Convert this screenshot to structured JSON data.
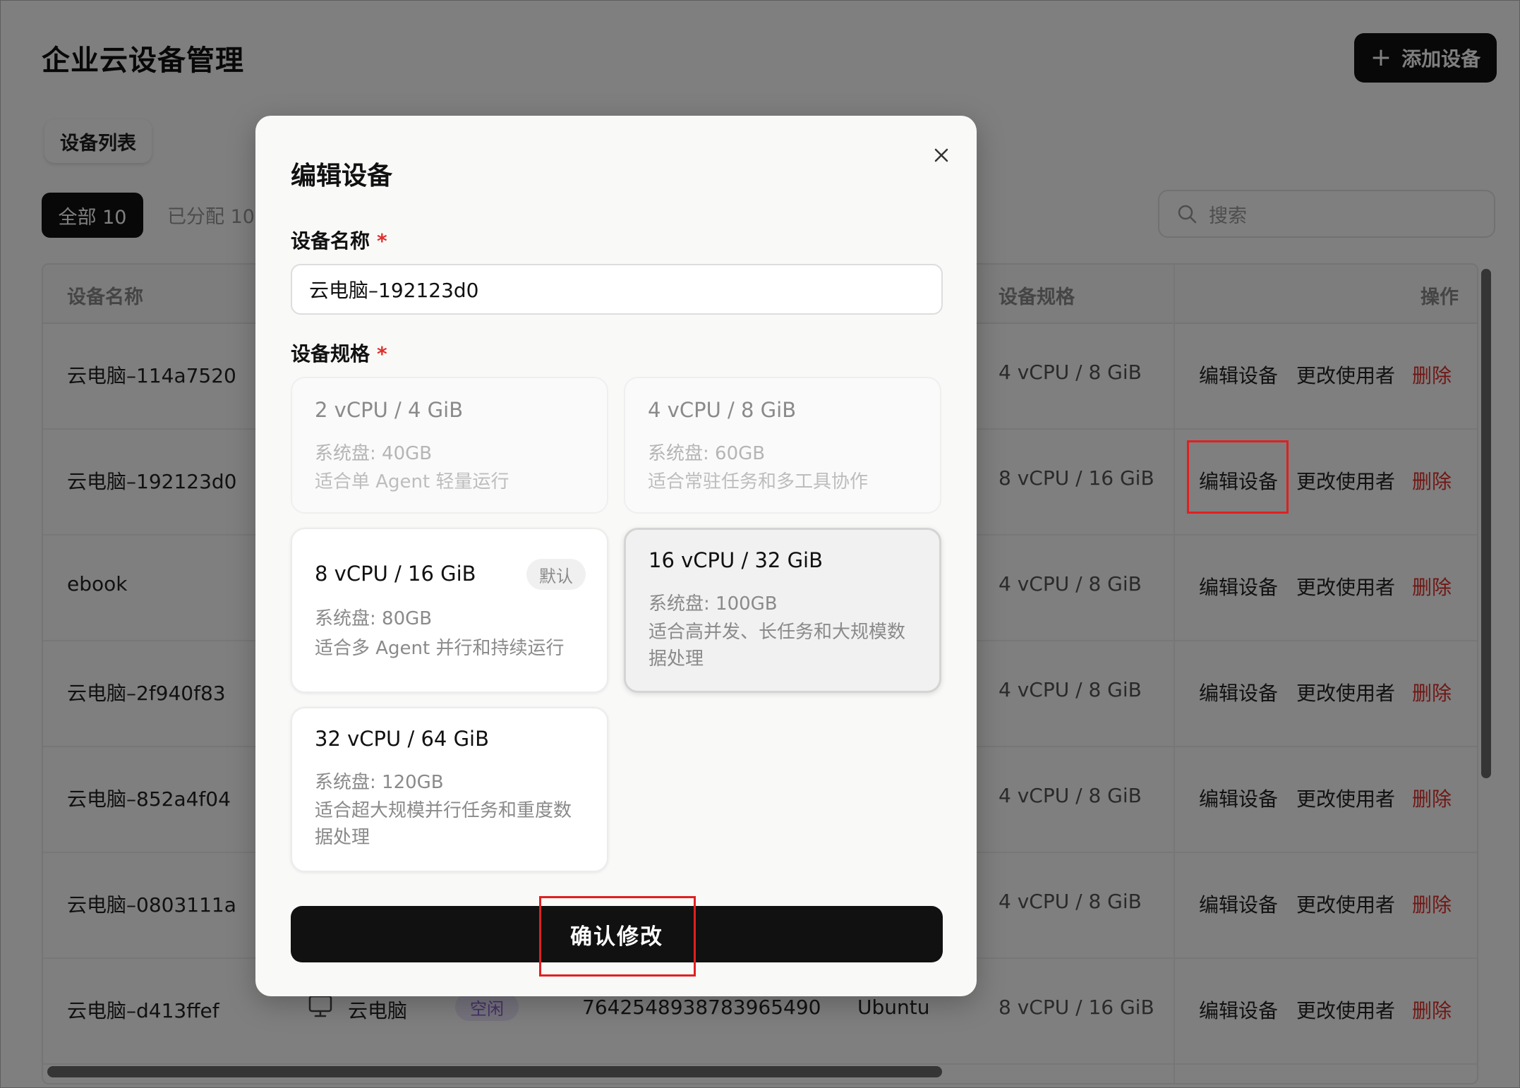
{
  "page": {
    "title": "企业云设备管理",
    "add_button": "添加设备",
    "tab": "设备列表",
    "filters": {
      "all": "全部 10",
      "assigned": "已分配 10"
    },
    "search_placeholder": "搜索"
  },
  "table": {
    "headers": {
      "name": "设备名称",
      "spec": "设备规格",
      "ops": "操作"
    },
    "op_labels": {
      "edit": "编辑设备",
      "change": "更改使用者",
      "delete": "删除"
    },
    "rows": [
      {
        "name": "云电脑–114a7520",
        "spec": "4 vCPU / 8 GiB"
      },
      {
        "name": "云电脑–192123d0",
        "spec": "8 vCPU / 16 GiB"
      },
      {
        "name": "ebook",
        "spec": "4 vCPU / 8 GiB"
      },
      {
        "name": "云电脑–2f940f83",
        "spec": "4 vCPU / 8 GiB"
      },
      {
        "name": "云电脑–852a4f04",
        "spec": "4 vCPU / 8 GiB"
      },
      {
        "name": "云电脑–0803111a",
        "spec": "4 vCPU / 8 GiB"
      },
      {
        "name": "云电脑–d413ffef",
        "type": "云电脑",
        "status": "空闲",
        "id": "7642548938783965490",
        "os": "Ubuntu",
        "spec": "8 vCPU / 16 GiB"
      }
    ]
  },
  "modal": {
    "title": "编辑设备",
    "name_label": "设备名称",
    "name_value": "云电脑–192123d0",
    "spec_label": "设备规格",
    "required_mark": "*",
    "specs": [
      {
        "title": "2 vCPU / 4 GiB",
        "disk": "系统盘: 40GB",
        "desc": "适合单 Agent 轻量运行",
        "state": "disabled"
      },
      {
        "title": "4 vCPU / 8 GiB",
        "disk": "系统盘: 60GB",
        "desc": "适合常驻任务和多工具协作",
        "state": "disabled"
      },
      {
        "title": "8 vCPU / 16 GiB",
        "disk": "系统盘: 80GB",
        "desc": "适合多 Agent 并行和持续运行",
        "badge": "默认",
        "state": "normal"
      },
      {
        "title": "16 vCPU / 32 GiB",
        "disk": "系统盘: 100GB",
        "desc": "适合高并发、长任务和大规模数据处理",
        "state": "selected"
      },
      {
        "title": "32 vCPU / 64 GiB",
        "disk": "系统盘: 120GB",
        "desc": "适合超大规模并行任务和重度数据处理",
        "state": "normal"
      }
    ],
    "confirm": "确认修改"
  },
  "colors": {
    "accent": "#111111",
    "danger": "#e0302b",
    "highlight": "#e02020",
    "status_idle_bg": "#ece6fb"
  }
}
